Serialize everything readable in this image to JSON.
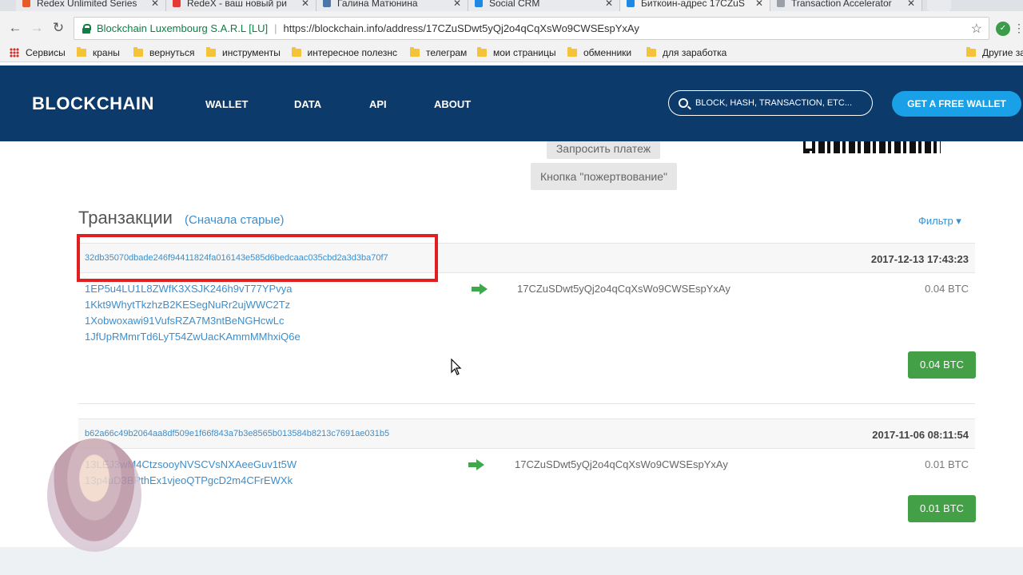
{
  "browser": {
    "tabs": [
      {
        "title": "Redex Unlimited Series",
        "color": "#e65b2a"
      },
      {
        "title": "RedeX - ваш новый ри",
        "color": "#e53935"
      },
      {
        "title": "Галина Матюнина",
        "color": "#4a76a8"
      },
      {
        "title": "Social CRM",
        "color": "#1e88e5"
      },
      {
        "title": "Биткоин-адрес 17CZuS",
        "color": "#1e88e5"
      },
      {
        "title": "Transaction Accelerator",
        "color": "#9aa0a6"
      }
    ],
    "omnibox": {
      "cert_name": "Blockchain Luxembourg S.A.R.L [LU]",
      "separator": "|",
      "url": "https://blockchain.info/address/17CZuSDwt5yQj2o4qCqXsWo9CWSEspYxAy"
    },
    "bookmarks": {
      "apps": "Сервисы",
      "items": [
        "краны",
        "вернуться",
        "инструменты",
        "интересное полезнс",
        "телеграм",
        "мои страницы",
        "обменники",
        "для заработка"
      ],
      "other": "Другие за"
    }
  },
  "site": {
    "logo": "BLOCKCHAIN",
    "nav": [
      "WALLET",
      "DATA",
      "API",
      "ABOUT"
    ],
    "search_placeholder": "BLOCK, HASH, TRANSACTION, ETC...",
    "cta": "GET A FREE WALLET",
    "brand_color": "#0c3a6b",
    "accent_color": "#1aa0e6"
  },
  "content": {
    "request_payment": "Запросить платеж",
    "donate_button": "Кнопка \"пожертвование\"",
    "section_title": "Транзакции",
    "section_sub": "(Сначала старые)",
    "filter": "Фильтр ▾",
    "transactions": [
      {
        "hash": "32db35070dbade246f94411824fa016143e585d6bedcaac035cbd2a3d3ba70f7",
        "date": "2017-12-13 17:43:23",
        "inputs": [
          "1EP5u4LU1L8ZWfK3XSJK246h9vT77YPvya",
          "1Kkt9WhytTkzhzB2KESegNuRr2ujWWC2Tz",
          "1Xobwoxawi91VufsRZA7M3ntBeNGHcwLc",
          "1JfUpRMmrTd6LyT54ZwUacKAmmMMhxiQ6e"
        ],
        "output": "17CZuSDwt5yQj2o4qCqXsWo9CWSEspYxAy",
        "amount": "0.04 BTC",
        "total": "0.04 BTC"
      },
      {
        "hash": "b62a66c49b2064aa8df509e1f66f843a7b3e8565b013584b8213c7691ae031b5",
        "date": "2017-11-06 08:11:54",
        "inputs": [
          "13LEJ3wM4CtzsooyNVSCVsNXAeeGuv1t5W",
          "13p4uD3BPthEx1vjeoQTPgcD2m4CFrEWXk"
        ],
        "output": "17CZuSDwt5yQj2o4qCqXsWo9CWSEspYxAy",
        "amount": "0.01 BTC",
        "total": "0.01 BTC"
      }
    ]
  }
}
